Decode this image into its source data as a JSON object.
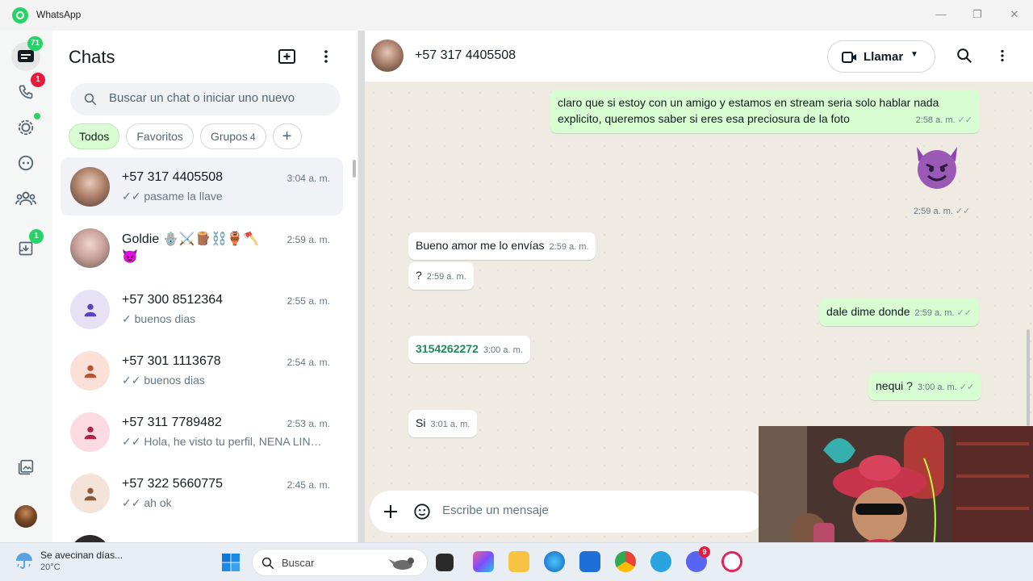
{
  "window": {
    "title": "WhatsApp"
  },
  "rail": {
    "chats_badge": "71",
    "calls_badge": "1",
    "archive_badge": "1"
  },
  "sidebar": {
    "title": "Chats",
    "search_placeholder": "Buscar un chat o iniciar uno nuevo",
    "filters": [
      {
        "label": "Todos",
        "count": ""
      },
      {
        "label": "Favoritos",
        "count": ""
      },
      {
        "label": "Grupos",
        "count": "4"
      }
    ],
    "chats": [
      {
        "name": "+57 317 4405508",
        "time": "3:04 a. m.",
        "last": "pasame la llave",
        "ticks": "✓✓"
      },
      {
        "name": "Goldie 🪬⚔️🪵⛓️🏺🪓",
        "name2": "😈",
        "time": "2:59 a. m.",
        "last": "",
        "ticks": ""
      },
      {
        "name": "+57 300 8512364",
        "time": "2:55 a. m.",
        "last": "buenos dias",
        "ticks": "✓"
      },
      {
        "name": "+57 301 1113678",
        "time": "2:54 a. m.",
        "last": "buenos dias",
        "ticks": "✓✓"
      },
      {
        "name": "+57 311 7789482",
        "time": "2:53 a. m.",
        "last": "Hola, he visto tu perfil, NENA LINDA...",
        "ticks": "✓✓"
      },
      {
        "name": "+57 322 5660775",
        "time": "2:45 a. m.",
        "last": "ah ok",
        "ticks": "✓✓"
      }
    ]
  },
  "conversation": {
    "contact": "+57 317 4405508",
    "call_label": "Llamar",
    "messages": [
      {
        "dir": "out",
        "text": "claro que si estoy con un amigo y estamos en stream seria solo hablar nada explicito, queremos saber si eres esa preciosura de la foto",
        "time": "2:58 a. m.",
        "ticks": "✓✓"
      },
      {
        "dir": "out",
        "text": "😈",
        "time": "2:59 a. m.",
        "ticks": "✓✓"
      },
      {
        "dir": "in",
        "text": "Bueno amor me lo envías",
        "time": "2:59 a. m."
      },
      {
        "dir": "in",
        "text": "?",
        "time": "2:59 a. m."
      },
      {
        "dir": "out",
        "text": "dale dime donde",
        "time": "2:59 a. m.",
        "ticks": "✓✓"
      },
      {
        "dir": "in",
        "text": "3154262272",
        "time": "3:00 a. m."
      },
      {
        "dir": "out",
        "text": "nequi ?",
        "time": "3:00 a. m.",
        "ticks": "✓✓"
      },
      {
        "dir": "in",
        "text": "Si",
        "time": "3:01 a. m."
      }
    ],
    "composer_placeholder": "Escribe un mensaje"
  },
  "taskbar": {
    "weather_text": "Se avecinan días...",
    "weather_temp": "20°C",
    "search_label": "Buscar",
    "discord_badge": "9"
  },
  "colors": {
    "accent": "#25d366",
    "outgoing": "#d9fdd3",
    "badge_red": "#e41b3a"
  }
}
